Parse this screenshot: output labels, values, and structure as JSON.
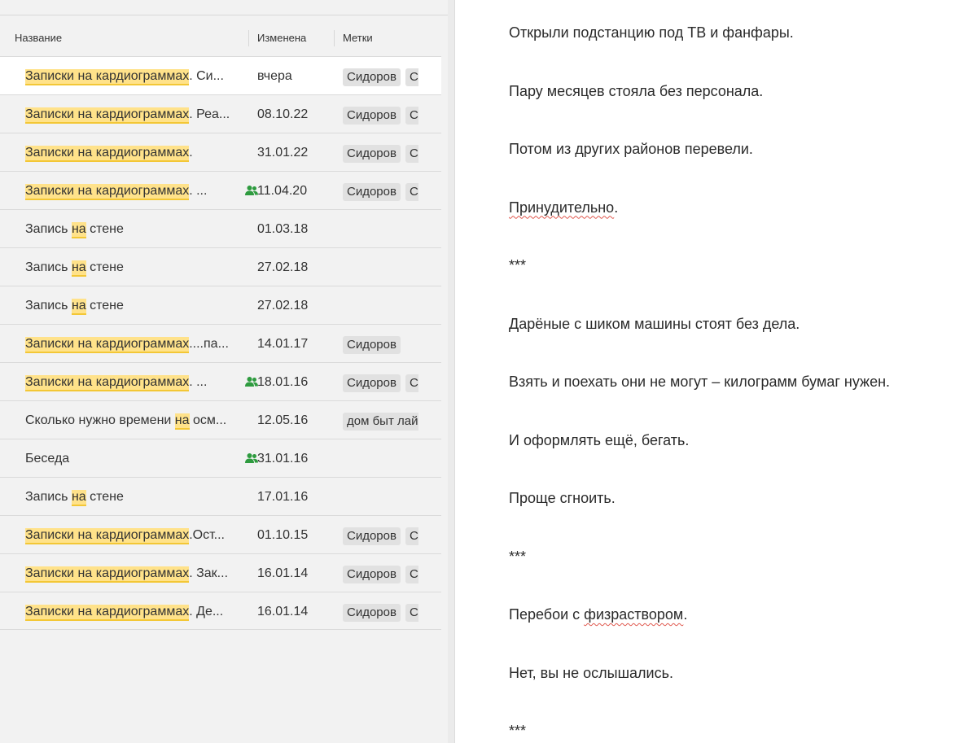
{
  "list": {
    "columns": {
      "name": "Название",
      "changed": "Изменена",
      "tags": "Метки"
    },
    "rows": [
      {
        "segments": [
          {
            "text": "Записки на кардиограммах",
            "hl": true
          },
          {
            "text": ". Си..."
          }
        ],
        "shared": false,
        "date": "вчера",
        "tags": [
          "Сидоров",
          "Си"
        ],
        "selected": true
      },
      {
        "segments": [
          {
            "text": "Записки на кардиограммах",
            "hl": true
          },
          {
            "text": ". Реа..."
          }
        ],
        "shared": false,
        "date": "08.10.22",
        "tags": [
          "Сидоров",
          "Си"
        ]
      },
      {
        "segments": [
          {
            "text": "Записки на кардиограммах",
            "hl": true
          },
          {
            "text": "."
          }
        ],
        "shared": false,
        "date": "31.01.22",
        "tags": [
          "Сидоров",
          "Си"
        ]
      },
      {
        "segments": [
          {
            "text": "Записки на кардиограммах",
            "hl": true
          },
          {
            "text": ". ..."
          }
        ],
        "shared": true,
        "date": "11.04.20",
        "tags": [
          "Сидоров",
          "Си"
        ]
      },
      {
        "segments": [
          {
            "text": "Запись "
          },
          {
            "text": "на",
            "hl": true
          },
          {
            "text": " стене"
          }
        ],
        "shared": false,
        "date": "01.03.18",
        "tags": []
      },
      {
        "segments": [
          {
            "text": "Запись "
          },
          {
            "text": "на",
            "hl": true
          },
          {
            "text": " стене"
          }
        ],
        "shared": false,
        "date": "27.02.18",
        "tags": []
      },
      {
        "segments": [
          {
            "text": "Запись "
          },
          {
            "text": "на",
            "hl": true
          },
          {
            "text": " стене"
          }
        ],
        "shared": false,
        "date": "27.02.18",
        "tags": []
      },
      {
        "segments": [
          {
            "text": "Записки на кардиограммах",
            "hl": true
          },
          {
            "text": "....па..."
          }
        ],
        "shared": false,
        "date": "14.01.17",
        "tags": [
          "Сидоров"
        ]
      },
      {
        "segments": [
          {
            "text": "Записки на кардиограммах",
            "hl": true
          },
          {
            "text": ". ..."
          }
        ],
        "shared": true,
        "date": "18.01.16",
        "tags": [
          "Сидоров",
          "Си"
        ]
      },
      {
        "segments": [
          {
            "text": "Сколько нужно времени "
          },
          {
            "text": "на",
            "hl": true
          },
          {
            "text": " осм..."
          }
        ],
        "shared": false,
        "date": "12.05.16",
        "tags": [
          "дом быт лайф"
        ]
      },
      {
        "segments": [
          {
            "text": "Беседа"
          }
        ],
        "shared": true,
        "date": "31.01.16",
        "tags": []
      },
      {
        "segments": [
          {
            "text": "Запись "
          },
          {
            "text": "на",
            "hl": true
          },
          {
            "text": " стене"
          }
        ],
        "shared": false,
        "date": "17.01.16",
        "tags": []
      },
      {
        "segments": [
          {
            "text": "Записки на кардиограммах",
            "hl": true
          },
          {
            "text": ".Ост..."
          }
        ],
        "shared": false,
        "date": "01.10.15",
        "tags": [
          "Сидоров",
          "Си"
        ]
      },
      {
        "segments": [
          {
            "text": "Записки на кардиограммах",
            "hl": true
          },
          {
            "text": ". Зак..."
          }
        ],
        "shared": false,
        "date": "16.01.14",
        "tags": [
          "Сидоров",
          "Си"
        ]
      },
      {
        "segments": [
          {
            "text": "Записки на кардиограммах",
            "hl": true
          },
          {
            "text": ". Де..."
          }
        ],
        "shared": false,
        "date": "16.01.14",
        "tags": [
          "Сидоров",
          "Си"
        ]
      }
    ]
  },
  "editor": {
    "paragraphs": [
      [
        {
          "text": "Открыли подстанцию под ТВ и фанфары."
        }
      ],
      [
        {
          "text": "Пару месяцев стояла без персонала."
        }
      ],
      [
        {
          "text": "Потом из других районов перевели."
        }
      ],
      [
        {
          "text": "Принудительно",
          "spell": true
        },
        {
          "text": "."
        }
      ],
      [
        {
          "text": "***"
        }
      ],
      [
        {
          "text": "Дарёные с шиком машины стоят без дела."
        }
      ],
      [
        {
          "text": "Взять и поехать они не могут – килограмм бумаг нужен."
        }
      ],
      [
        {
          "text": "И оформлять ещё, бегать."
        }
      ],
      [
        {
          "text": "Проще сгноить."
        }
      ],
      [
        {
          "text": "***"
        }
      ],
      [
        {
          "text": "Перебои с "
        },
        {
          "text": "физраствором",
          "spell": true
        },
        {
          "text": "."
        }
      ],
      [
        {
          "text": "Нет, вы не ослышались."
        }
      ],
      [
        {
          "text": "***"
        }
      ]
    ]
  },
  "colors": {
    "highlight": "#ffe28a",
    "shared_icon": "#2e9b3f",
    "spellcheck": "#e0584e"
  }
}
